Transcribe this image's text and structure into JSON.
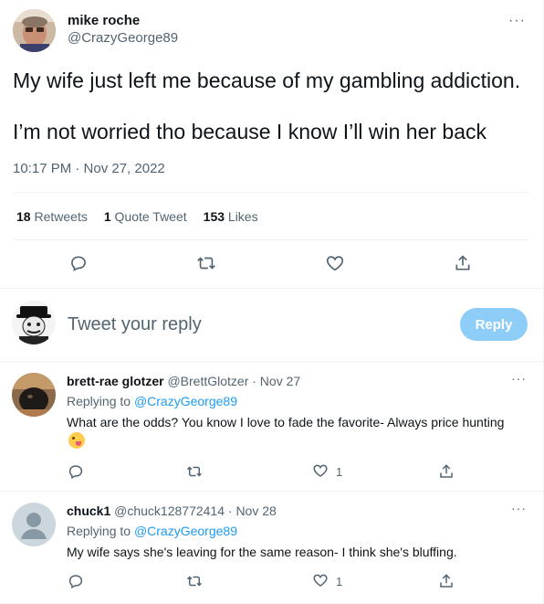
{
  "tweet": {
    "author_name": "mike roche",
    "author_handle": "@CrazyGeorge89",
    "more_label": "···",
    "text_line1": "My wife just left me because of my gambling addiction.",
    "text_line2": "I’m not worried tho because I know I’ll win her back",
    "timestamp": "10:17 PM · Nov 27, 2022",
    "stats": {
      "retweets_count": "18",
      "retweets_label": "Retweets",
      "quotes_count": "1",
      "quotes_label": "Quote Tweet",
      "likes_count": "153",
      "likes_label": "Likes"
    },
    "actions": [
      "reply-icon",
      "retweet-icon",
      "like-icon",
      "share-icon"
    ]
  },
  "composer": {
    "placeholder": "Tweet your reply",
    "button_label": "Reply"
  },
  "replies": [
    {
      "name": "brett-rae glotzer",
      "meta": "@BrettGlotzer · Nov 27",
      "replying_label": "Replying to",
      "replying_handle": "@CrazyGeorge89",
      "text": "What are the odds?  You know I love to fade the favorite- Always price hunting",
      "likes": "1",
      "more_label": "···"
    },
    {
      "name": "chuck1",
      "meta": "@chuck128772414 · Nov 28",
      "replying_label": "Replying to",
      "replying_handle": "@CrazyGeorge89",
      "text": "My wife says she's leaving for the same reason- I think she's bluffing.",
      "likes": "1",
      "more_label": "···"
    }
  ],
  "colors": {
    "accent": "#1d9bf0",
    "reply_button_disabled": "#8ecdf8",
    "secondary_text": "#536471",
    "divider": "#eff3f4"
  }
}
